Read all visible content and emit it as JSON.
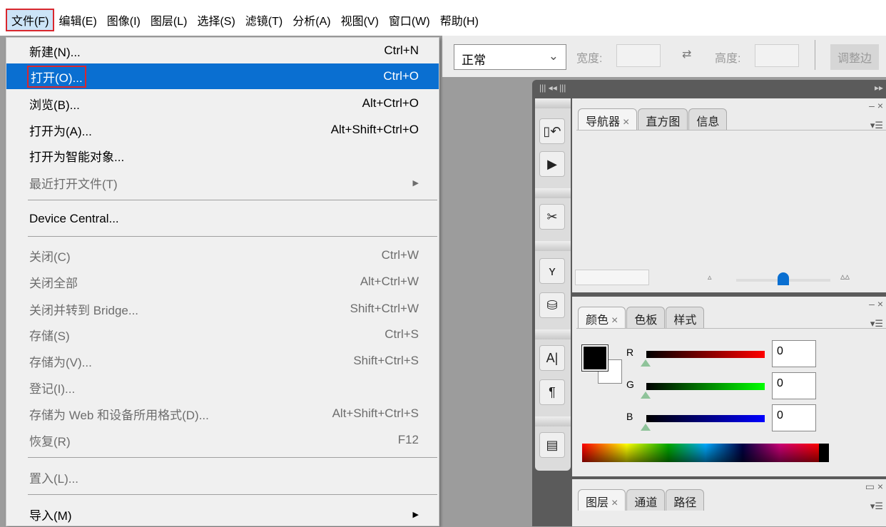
{
  "menubar": [
    "文件(F)",
    "编辑(E)",
    "图像(I)",
    "图层(L)",
    "选择(S)",
    "滤镜(T)",
    "分析(A)",
    "视图(V)",
    "窗口(W)",
    "帮助(H)"
  ],
  "toolbar": {
    "mode": "正常",
    "width_label": "宽度:",
    "height_label": "高度:",
    "swap_icon": "swap-arrows-icon",
    "adjust_button": "调整边"
  },
  "file_menu": [
    {
      "label": "新建(N)...",
      "shortcut": "Ctrl+N"
    },
    {
      "label": "打开(O)...",
      "shortcut": "Ctrl+O",
      "highlighted": true
    },
    {
      "label": "浏览(B)...",
      "shortcut": "Alt+Ctrl+O"
    },
    {
      "label": "打开为(A)...",
      "shortcut": "Alt+Shift+Ctrl+O"
    },
    {
      "label": "打开为智能对象...",
      "shortcut": ""
    },
    {
      "label": "最近打开文件(T)",
      "shortcut": "",
      "disabled": true,
      "submenu": true
    },
    {
      "label": "Device Central...",
      "shortcut": ""
    },
    {
      "label": "关闭(C)",
      "shortcut": "Ctrl+W",
      "disabled": true
    },
    {
      "label": "关闭全部",
      "shortcut": "Alt+Ctrl+W",
      "disabled": true
    },
    {
      "label": "关闭并转到 Bridge...",
      "shortcut": "Shift+Ctrl+W",
      "disabled": true
    },
    {
      "label": "存储(S)",
      "shortcut": "Ctrl+S",
      "disabled": true
    },
    {
      "label": "存储为(V)...",
      "shortcut": "Shift+Ctrl+S",
      "disabled": true
    },
    {
      "label": "登记(I)...",
      "shortcut": "",
      "disabled": true
    },
    {
      "label": "存储为 Web 和设备所用格式(D)...",
      "shortcut": "Alt+Shift+Ctrl+S",
      "disabled": true
    },
    {
      "label": "恢复(R)",
      "shortcut": "F12",
      "disabled": true
    },
    {
      "label": "置入(L)...",
      "shortcut": "",
      "disabled": true
    },
    {
      "label": "导入(M)",
      "shortcut": "",
      "submenu": true
    }
  ],
  "navigator_panel": {
    "tabs": [
      "导航器",
      "直方图",
      "信息"
    ]
  },
  "color_panel": {
    "tabs": [
      "颜色",
      "色板",
      "样式"
    ],
    "channels": [
      {
        "name": "R",
        "value": "0",
        "color": "#ff0000"
      },
      {
        "name": "G",
        "value": "0",
        "color": "#00ff00"
      },
      {
        "name": "B",
        "value": "0",
        "color": "#0000ff"
      }
    ],
    "foreground": "#000000",
    "background": "#ffffff"
  },
  "layers_panel": {
    "tabs": [
      "图层",
      "通道",
      "路径"
    ]
  },
  "accent": "#0a6fd1"
}
